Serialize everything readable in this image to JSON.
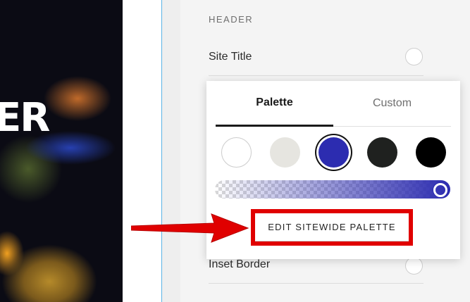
{
  "hero": {
    "text": "ER"
  },
  "panel": {
    "section_heading": "HEADER",
    "rows": [
      {
        "label": "Site Title"
      },
      {
        "label": "Inset Border"
      }
    ]
  },
  "color_picker": {
    "tabs": [
      {
        "label": "Palette",
        "active": true
      },
      {
        "label": "Custom",
        "active": false
      }
    ],
    "swatches": [
      {
        "color": "#ffffff",
        "selected": false
      },
      {
        "color": "#e6e5e0",
        "selected": false
      },
      {
        "color": "#2c2cb0",
        "selected": true
      },
      {
        "color": "#1f211f",
        "selected": false
      },
      {
        "color": "#000000",
        "selected": false
      }
    ],
    "opacity_level": 1.0,
    "edit_button_label": "EDIT SITEWIDE PALETTE"
  },
  "annotation": {
    "highlight_color": "#e00000"
  }
}
